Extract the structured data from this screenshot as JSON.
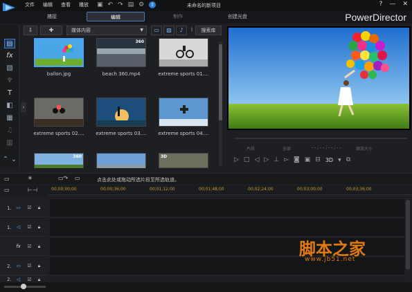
{
  "menu": [
    "文件",
    "编辑",
    "查看",
    "播放"
  ],
  "project_title": "未命名的新项目",
  "window_controls": [
    "?",
    "—",
    "✕"
  ],
  "modes": {
    "capture": "捕捉",
    "edit": "编辑",
    "produce": "制作",
    "disc": "创建光盘"
  },
  "brand": "PowerDirector",
  "library": {
    "dropdown": "媒体内容",
    "search": "搜索库",
    "items": [
      {
        "caption": "ballon.jpg",
        "badge": "",
        "selected": true
      },
      {
        "caption": "beach 360.mp4",
        "badge": "360",
        "selected": false
      },
      {
        "caption": "extreme sports 01....",
        "badge": "",
        "selected": false
      },
      {
        "caption": "extreme sports 02....",
        "badge": "",
        "selected": false
      },
      {
        "caption": "extreme sports 03....",
        "badge": "",
        "selected": false
      },
      {
        "caption": "extreme sports 04....",
        "badge": "",
        "selected": false
      },
      {
        "caption": "",
        "badge": "360",
        "selected": false
      },
      {
        "caption": "",
        "badge": "",
        "selected": false
      },
      {
        "caption": "",
        "badge": "3D",
        "selected": false
      }
    ]
  },
  "preview": {
    "btn_clip": "片段",
    "btn_movie": "全部",
    "timecode": "- - ; - - ; - - ; - -",
    "fit": "缩放大小",
    "mode_3d": "3D"
  },
  "timeline": {
    "hint": "点击此处或拖动所选片段至所选轨道。",
    "ticks": [
      "00;00;00;00",
      "00;00;36;00",
      "00;01;12;00",
      "00;01;48;00",
      "00;02;24;00",
      "00;03;00;00",
      "00;03;36;00"
    ],
    "tracks": [
      {
        "num": "1.",
        "type": "video"
      },
      {
        "num": "1.",
        "type": "audio"
      },
      {
        "num": "",
        "type": "fx",
        "label": "fx"
      },
      {
        "num": "2.",
        "type": "video"
      },
      {
        "num": "2.",
        "type": "audio"
      }
    ]
  },
  "watermark": {
    "title": "脚本之家",
    "url": "www.jb51.net"
  },
  "colors": {
    "accent": "#4aa3ff",
    "ruler_text": "#c89a3a",
    "watermark": "#e07a10"
  }
}
